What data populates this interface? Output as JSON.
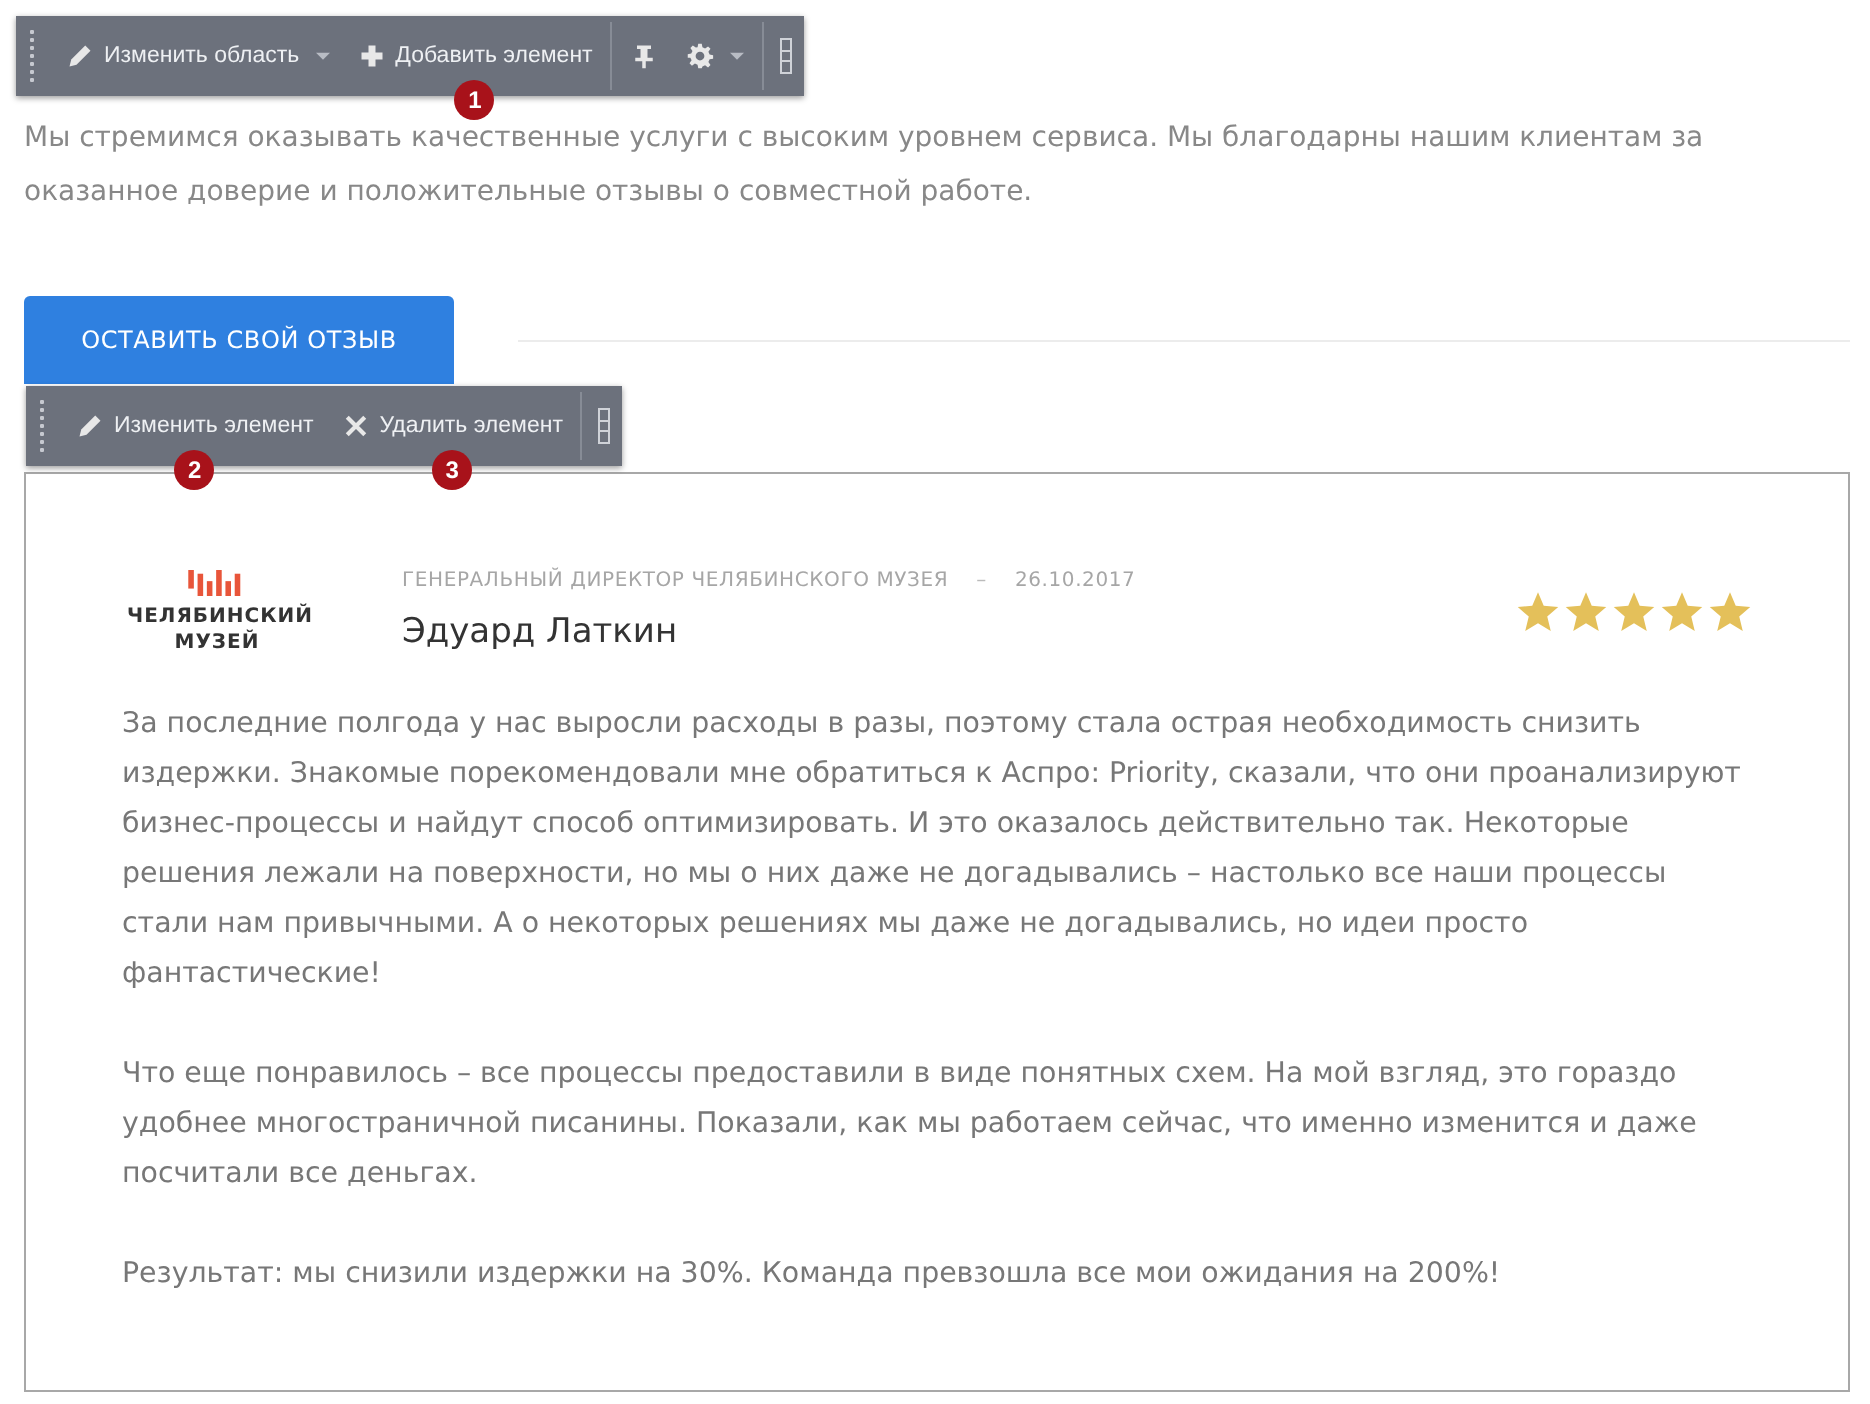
{
  "intro": "Мы стремимся оказывать качественные услуги с высоким уровнем сервиса. Мы благодарны нашим клиентам за оказанное доверие и положительные отзывы о совместной работе.",
  "review_button": "ОСТАВИТЬ СВОЙ ОТЗЫВ",
  "toolbars": [
    {
      "items": [
        {
          "kind": "edit",
          "label": "Изменить область",
          "dropdown": true
        },
        {
          "kind": "add",
          "label": "Добавить элемент",
          "dropdown": false,
          "badge": "1"
        },
        {
          "kind": "pin",
          "dropdown": false
        },
        {
          "kind": "settings",
          "dropdown": true
        }
      ]
    },
    {
      "items": [
        {
          "kind": "edit",
          "label": "Изменить элемент",
          "dropdown": false,
          "badge": "2"
        },
        {
          "kind": "delete",
          "label": "Удалить элемент",
          "dropdown": false,
          "badge": "3"
        }
      ]
    }
  ],
  "review": {
    "logo_text": "ЧЕЛЯБИНСКИЙ МУЗЕЙ",
    "position": "ГЕНЕРАЛЬНЫЙ ДИРЕКТОР ЧЕЛЯБИНСКОГО МУЗЕЯ",
    "separator": "–",
    "date": "26.10.2017",
    "name": "Эдуард Латкин",
    "stars": 5,
    "paragraphs": [
      "За последние полгода у нас выросли расходы в разы, поэтому стала острая необходимость снизить издержки. Знакомые порекомендовали мне обратиться к Аспро: Priority, сказали, что они проанализируют бизнес-процессы и найдут способ оптимизировать. И это оказалось действительно так. Некоторые решения лежали на поверхности, но мы о них даже не догадывались – настолько все наши процессы стали нам привычными. А о некоторых решениях мы даже не догадывались, но идеи просто фантастические!",
      "Что еще понравилось – все процессы предоставили в виде понятных схем. На мой взгляд, это гораздо удобнее многостраничной писанины. Показали, как мы работаем сейчас, что именно изменится и даже посчитали все деньгах.",
      "Результат: мы снизили издержки на 30%. Команда превзошла все мои ожидания на 200%!"
    ]
  }
}
